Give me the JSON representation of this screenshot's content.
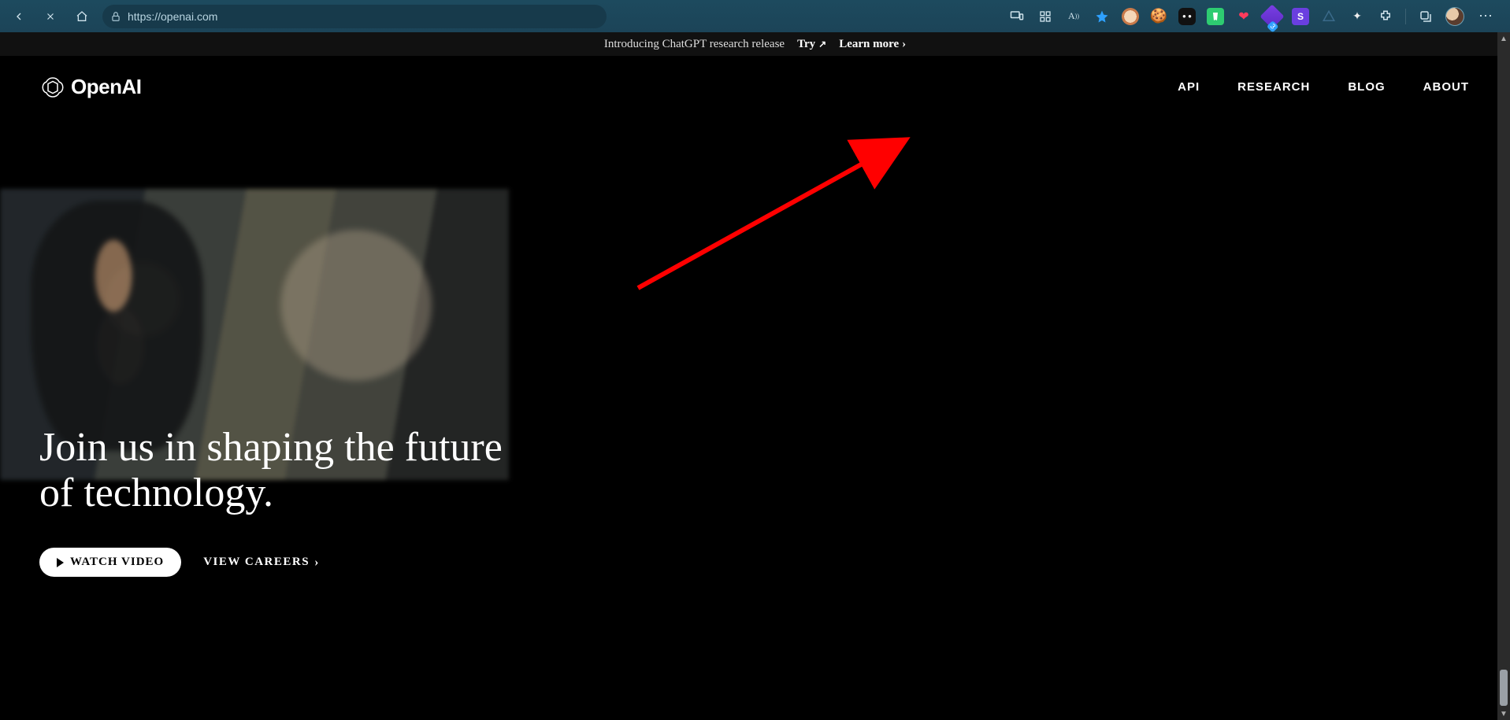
{
  "browser": {
    "url": "https://openai.com",
    "extension_badge": "3"
  },
  "announcement": {
    "intro": "Introducing ChatGPT research release",
    "try": "Try",
    "learn_more": "Learn more"
  },
  "brand": {
    "name": "OpenAI"
  },
  "nav": {
    "items": [
      {
        "label": "API"
      },
      {
        "label": "RESEARCH"
      },
      {
        "label": "BLOG"
      },
      {
        "label": "ABOUT"
      }
    ]
  },
  "hero": {
    "headline_line1": "Join us in shaping the future",
    "headline_line2": "of technology.",
    "watch_video": "WATCH VIDEO",
    "view_careers": "VIEW CAREERS"
  }
}
